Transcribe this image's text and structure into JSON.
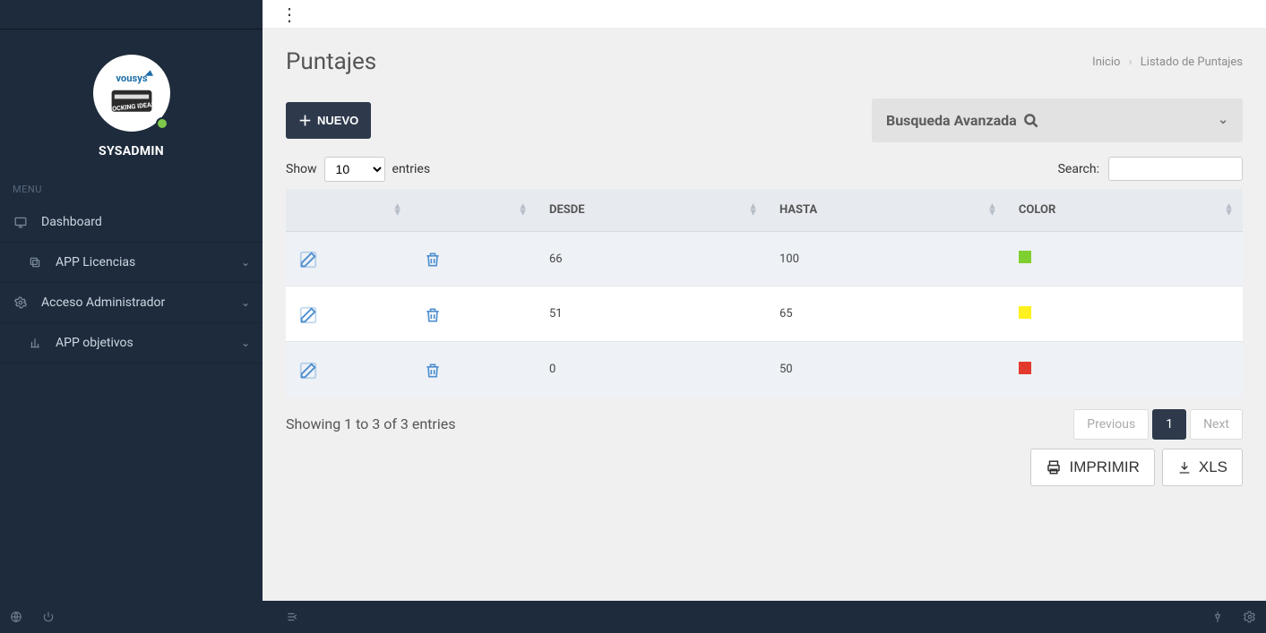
{
  "menu_label": "MENU",
  "profile": {
    "name": "SYSADMIN"
  },
  "sidebar": {
    "items": [
      {
        "icon": "monitor",
        "label": "Dashboard",
        "expandable": false
      },
      {
        "icon": "copy",
        "label": "APP Licencias",
        "expandable": true
      },
      {
        "icon": "gear",
        "label": "Acceso Administrador",
        "expandable": true
      },
      {
        "icon": "chart",
        "label": "APP objetivos",
        "expandable": true
      }
    ]
  },
  "page": {
    "title": "Puntajes",
    "breadcrumbs": {
      "root": "Inicio",
      "current": "Listado de Puntajes"
    },
    "new_button": "NUEVO",
    "advanced_search": "Busqueda Avanzada",
    "show_label": "Show",
    "entries_label": "entries",
    "page_size": "10",
    "search_label": "Search:",
    "search_value": "",
    "columns": {
      "c1": "",
      "c2": "",
      "c3": "DESDE",
      "c4": "HASTA",
      "c5": "COLOR"
    },
    "rows": [
      {
        "desde": "66",
        "hasta": "100",
        "color": "#7fcf30"
      },
      {
        "desde": "51",
        "hasta": "65",
        "color": "#fff01f"
      },
      {
        "desde": "0",
        "hasta": "50",
        "color": "#e23a2d"
      }
    ],
    "info_text": "Showing 1 to 3 of 3 entries",
    "pager": {
      "prev": "Previous",
      "page": "1",
      "next": "Next"
    },
    "print_label": "IMPRIMIR",
    "xls_label": "XLS"
  }
}
